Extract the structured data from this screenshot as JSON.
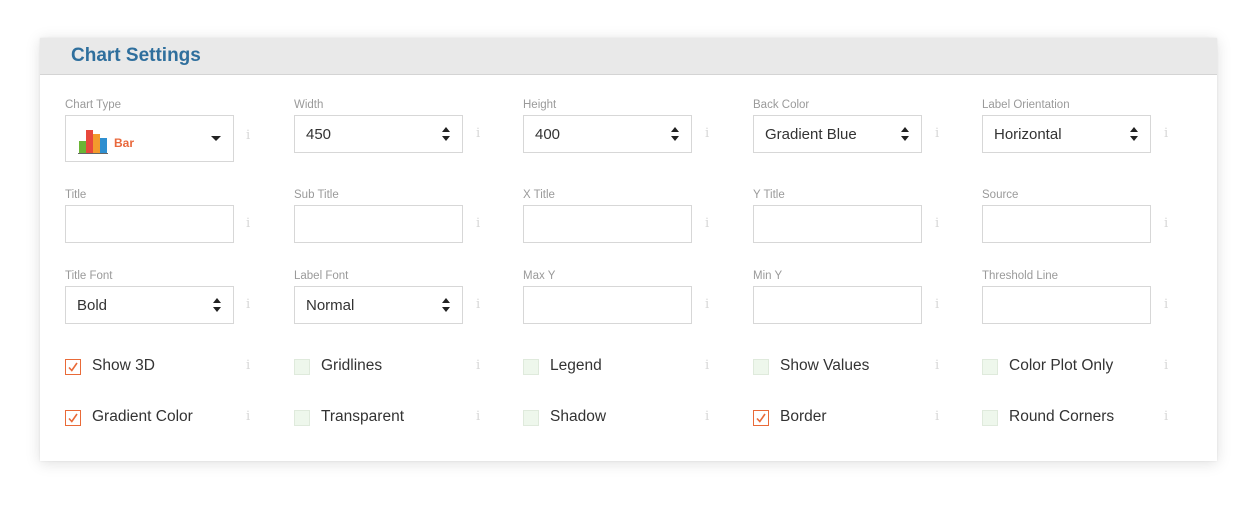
{
  "panel": {
    "title": "Chart Settings"
  },
  "fields": {
    "chart_type": {
      "label": "Chart Type",
      "value": "Bar"
    },
    "width": {
      "label": "Width",
      "value": "450"
    },
    "height": {
      "label": "Height",
      "value": "400"
    },
    "back_color": {
      "label": "Back Color",
      "value": "Gradient Blue"
    },
    "label_orientation": {
      "label": "Label Orientation",
      "value": "Horizontal"
    },
    "title": {
      "label": "Title",
      "value": ""
    },
    "sub_title": {
      "label": "Sub Title",
      "value": ""
    },
    "x_title": {
      "label": "X Title",
      "value": ""
    },
    "y_title": {
      "label": "Y Title",
      "value": ""
    },
    "source": {
      "label": "Source",
      "value": ""
    },
    "title_font": {
      "label": "Title Font",
      "value": "Bold"
    },
    "label_font": {
      "label": "Label Font",
      "value": "Normal"
    },
    "max_y": {
      "label": "Max Y",
      "value": ""
    },
    "min_y": {
      "label": "Min Y",
      "value": ""
    },
    "threshold_line": {
      "label": "Threshold Line",
      "value": ""
    }
  },
  "info_glyph": "i",
  "checkboxes": [
    {
      "label": "Show 3D",
      "checked": true
    },
    {
      "label": "Gridlines",
      "checked": false
    },
    {
      "label": "Legend",
      "checked": false
    },
    {
      "label": "Show Values",
      "checked": false
    },
    {
      "label": "Color Plot Only",
      "checked": false
    },
    {
      "label": "Gradient Color",
      "checked": true
    },
    {
      "label": "Transparent",
      "checked": false
    },
    {
      "label": "Shadow",
      "checked": false
    },
    {
      "label": "Border",
      "checked": true
    },
    {
      "label": "Round Corners",
      "checked": false
    }
  ],
  "colors": {
    "title": "#2f6f9d",
    "check_accent": "#e96a38",
    "bar_label": "#e9683c"
  },
  "icons": {
    "chart_type": "bar-chart-icon",
    "select": "up-down-spinner-icon",
    "dropdown": "caret-down-icon",
    "info": "info-icon",
    "checkmark": "checkmark-icon"
  }
}
